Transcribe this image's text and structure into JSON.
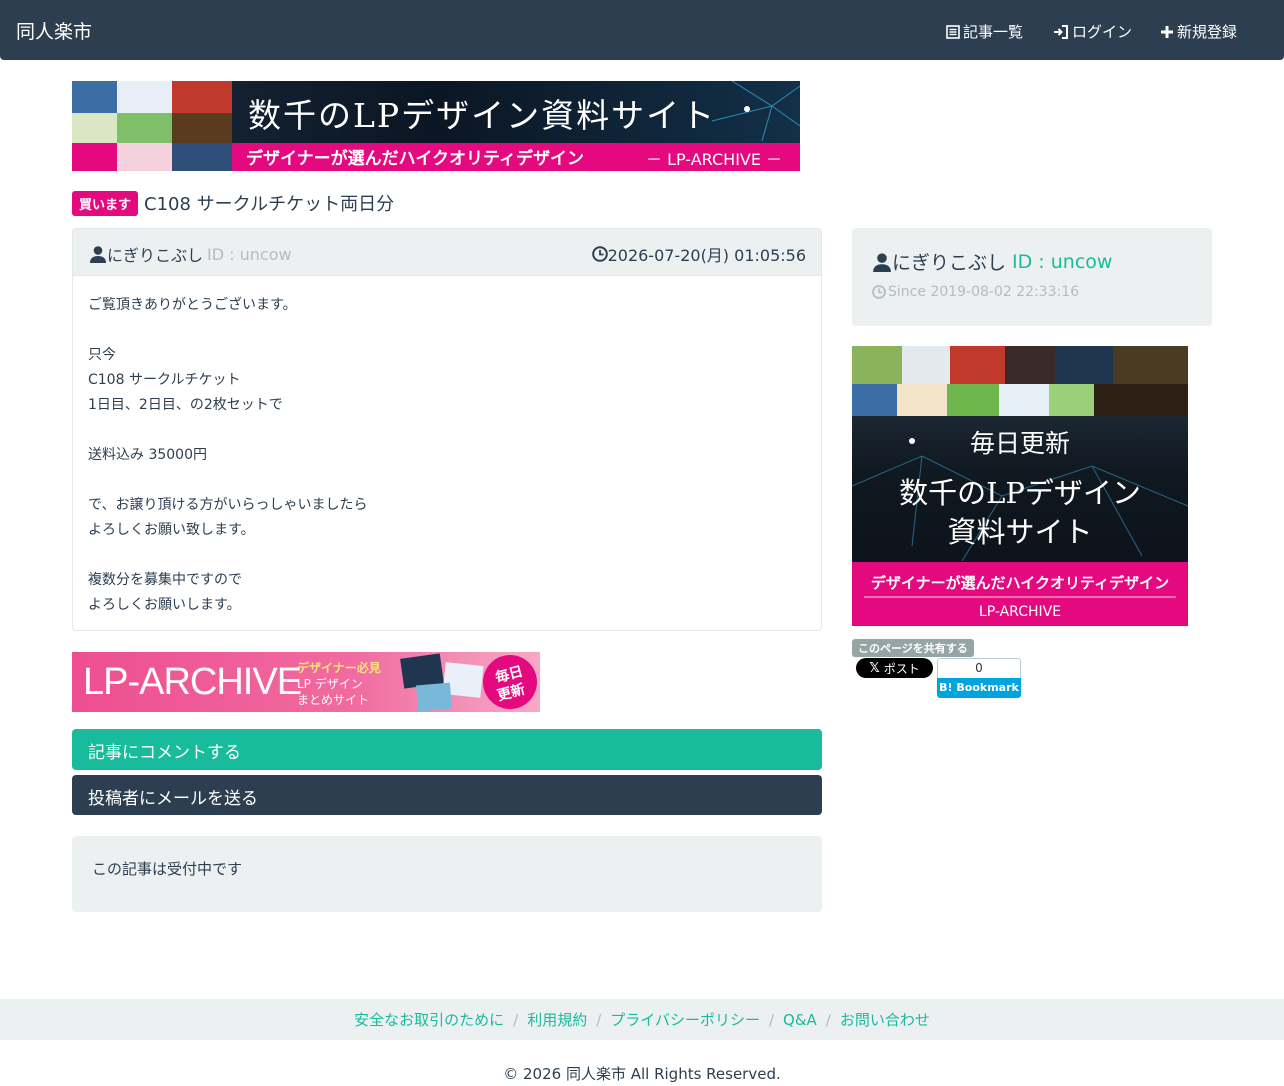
{
  "header": {
    "brand": "同人楽市",
    "nav": [
      {
        "label": "記事一覧",
        "icon": "list-icon"
      },
      {
        "label": "ログイン",
        "icon": "login-icon"
      },
      {
        "label": "新規登録",
        "icon": "plus-icon"
      }
    ]
  },
  "banner_top": {
    "headline": "数千のLPデザイン資料サイト",
    "tagline": "デザイナーが選んだハイクオリティデザイン",
    "brand": "－ LP-ARCHIVE －"
  },
  "post": {
    "badge": "買います",
    "title": "C108 サークルチケット両日分",
    "author": "にぎりこぶし",
    "author_id": "ID : uncow",
    "date": "2026-07-20(月) 01:05:56",
    "body": [
      "ご覧頂きありがとうございます。",
      "",
      "只今",
      "C108 サークルチケット",
      "1日目、2日目、の2枚セットで",
      "",
      "送料込み 35000円",
      "",
      "で、お譲り頂ける方がいらっしゃいましたら",
      "よろしくお願い致します。",
      "",
      "複数分を募集中ですので",
      "よろしくお願いします。"
    ]
  },
  "banner_mid": {
    "brand": "LP-ARCHIVE",
    "line1": "デザイナー必見",
    "line2": "LP デザイン",
    "line3": "まとめサイト",
    "stamp1": "毎日",
    "stamp2": "更新"
  },
  "actions": {
    "comment": "記事にコメントする",
    "mail": "投稿者にメールを送る"
  },
  "status": {
    "text": "この記事は受付中です"
  },
  "sidebar": {
    "author": "にぎりこぶし",
    "author_id": "ID : uncow",
    "since": "Since 2019-08-02 22:33:16",
    "banner": {
      "daily": "毎日更新",
      "line1": "数千のLPデザイン",
      "line2": "資料サイト",
      "tagline": "デザイナーが選んだハイクオリティデザイン",
      "brand": "LP-ARCHIVE"
    },
    "share_label": "このページを共有する",
    "x_post": "ポスト",
    "hatena_count": "0",
    "hatena_label": "B! Bookmark"
  },
  "footer": {
    "links": [
      "安全なお取引のために",
      "利用規約",
      "プライバシーポリシー",
      "Q&A",
      "お問い合わせ"
    ],
    "copyright": "© 2026 同人楽市 All Rights Reserved."
  },
  "colors": {
    "navbar": "#2c3e50",
    "accent": "#18bc9c",
    "badge": "#e5097f",
    "panel": "#ecf0f1"
  }
}
